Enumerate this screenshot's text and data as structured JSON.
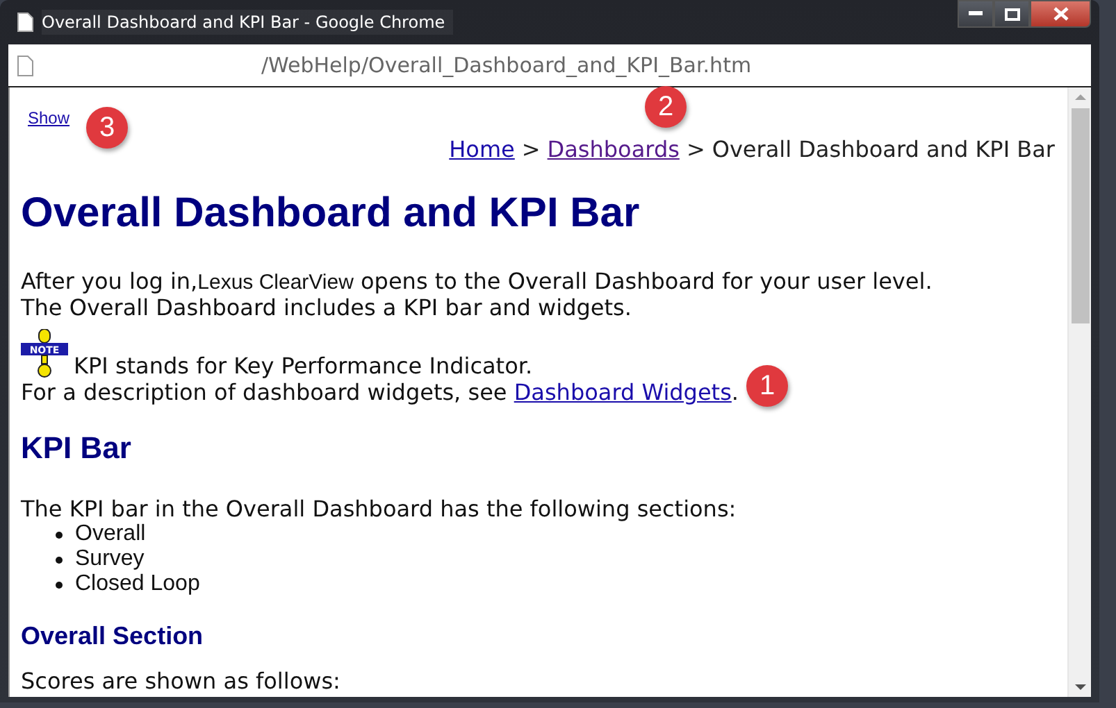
{
  "window": {
    "title": "Overall Dashboard and KPI Bar - Google Chrome",
    "address": "/WebHelp/Overall_Dashboard_and_KPI_Bar.htm"
  },
  "page": {
    "show_link": "Show",
    "breadcrumb": [
      {
        "label": "Home",
        "kind": "link",
        "visited": false
      },
      {
        "label": ">",
        "kind": "separator"
      },
      {
        "label": "Dashboards",
        "kind": "link",
        "visited": true
      },
      {
        "label": ">",
        "kind": "separator"
      },
      {
        "label": "Overall Dashboard and KPI Bar",
        "kind": "current"
      }
    ],
    "title": "Overall Dashboard and KPI Bar",
    "intro": {
      "lead": "After you log in,",
      "product": "Lexus ClearView",
      "rest": " opens to the Overall Dashboard for your user level."
    },
    "intro_line_2": "The Overall Dashboard includes a KPI bar and widgets.",
    "note": {
      "icon_label": "NOTE",
      "text": "KPI stands for Key Performance Indicator."
    },
    "see_also": {
      "lead": "For a description of dashboard widgets, see ",
      "link": "Dashboard Widgets",
      "tail": "."
    },
    "section": {
      "heading": "KPI Bar",
      "text": "The KPI bar in the Overall Dashboard has the following sections:",
      "items": [
        "Overall",
        "Survey",
        "Closed Loop"
      ]
    },
    "subsection": {
      "heading": "Overall Section",
      "text": "Scores are shown as follows:"
    }
  },
  "callouts": [
    {
      "number": "1"
    },
    {
      "number": "2"
    },
    {
      "number": "3"
    }
  ]
}
